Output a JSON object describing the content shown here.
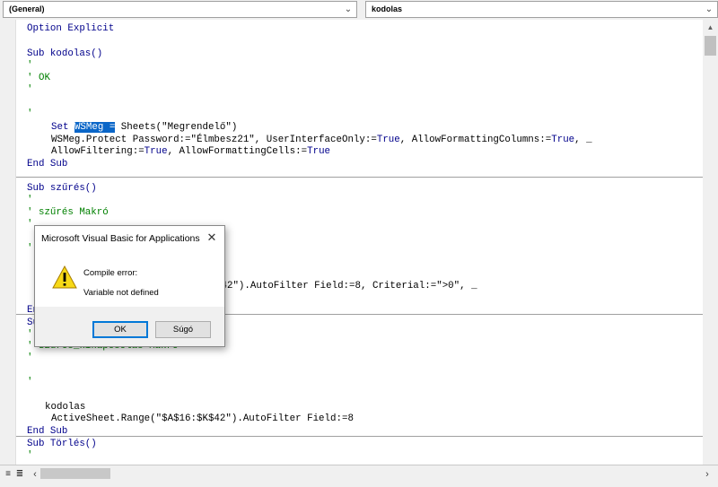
{
  "toolbar": {
    "object_combo": "(General)",
    "procedure_combo": "kodolas"
  },
  "code": {
    "line1": "Option Explicit",
    "sub1_decl": "Sub kodolas()",
    "apostrophe": "'",
    "comment_ok": "' OK",
    "set_kw": "Set",
    "sel_text": "WSMeg =",
    "sheets_text": " Sheets(\"Megrendelő\")",
    "protect_a": "WSMeg.Protect Password:=\"Élmbesz21\", UserInterfaceOnly:=",
    "true_kw": "True",
    "protect_b": ", AllowFormattingColumns:=",
    "protect_c": ", _",
    "filter_a": "AllowFiltering:=",
    "filter_b": ", AllowFormattingCells:=",
    "end_sub": "End Sub",
    "sub2_decl": "Sub szűrés()",
    "comment_szures": "' szűrés Makró",
    "autofilter_partial": "$42\").AutoFilter Field:=8, Criterial:=\">0\", _",
    "obscured_end": "En",
    "obscured_sub": "Su",
    "comment_kikapcs": "' Szűrés_kikapcsolás Makró",
    "call_kodolas": "kodolas",
    "active_sheet": "ActiveSheet.Range(\"$A$16:$K$42\").AutoFilter Field:=8",
    "sub4_decl": "Sub Törlés()"
  },
  "dialog": {
    "title": "Microsoft Visual Basic for Applications",
    "message_line1": "Compile error:",
    "message_line2": "Variable not defined",
    "ok_label": "OK",
    "help_label": "Súgó"
  },
  "colors": {
    "keyword": "#00008b",
    "comment": "#008000",
    "selection": "#0a66c8",
    "focus_border": "#0078d7"
  },
  "icons": [
    "chevron-down-icon",
    "warning-icon",
    "close-icon",
    "procedure-view-icon",
    "module-view-icon",
    "scroll-left-icon",
    "scroll-right-icon",
    "scroll-up-icon"
  ]
}
